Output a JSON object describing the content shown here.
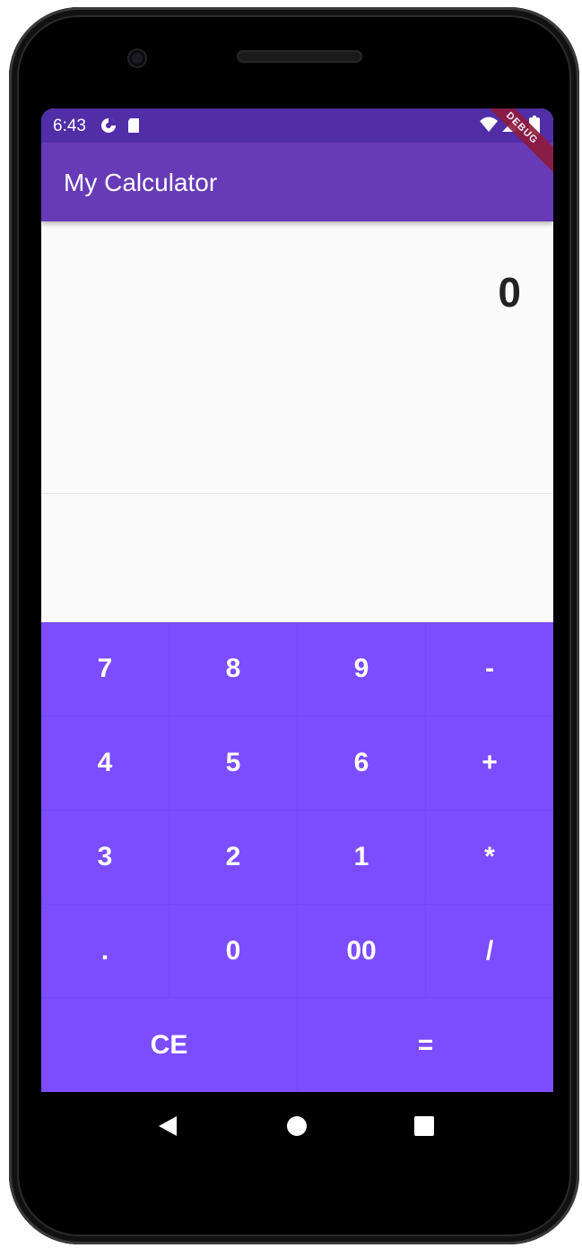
{
  "status_bar": {
    "time": "6:43"
  },
  "app_bar": {
    "title": "My Calculator"
  },
  "debug_banner": "DEBUG",
  "display": {
    "value": "0"
  },
  "keys": {
    "row1": [
      "7",
      "8",
      "9",
      "-"
    ],
    "row2": [
      "4",
      "5",
      "6",
      "+"
    ],
    "row3": [
      "3",
      "2",
      "1",
      "*"
    ],
    "row4": [
      ".",
      "0",
      "00",
      "/"
    ],
    "row5": [
      "CE",
      "="
    ]
  },
  "colors": {
    "status_bar": "#512da8",
    "app_bar": "#673ab7",
    "keypad": "#7c4dff",
    "display_text": "#222222"
  }
}
